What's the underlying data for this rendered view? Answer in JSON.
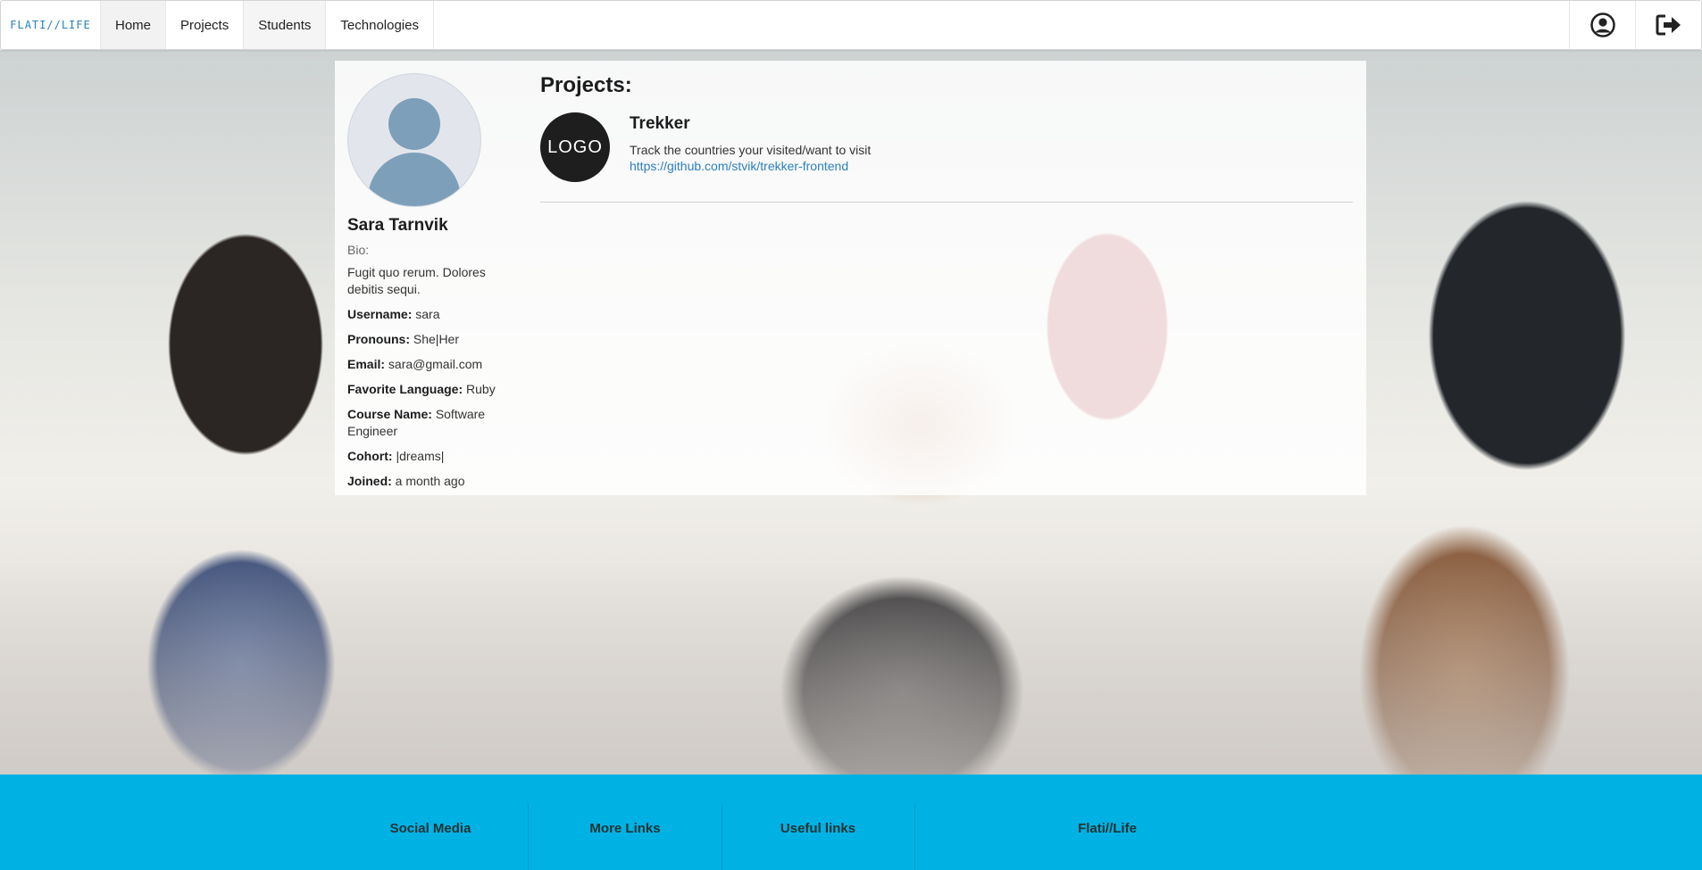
{
  "nav": {
    "logo": "FLATI//LIFE",
    "items": [
      "Home",
      "Projects",
      "Students",
      "Technologies"
    ]
  },
  "profile": {
    "name": "Sara Tarnvik",
    "bio_label": "Bio:",
    "bio": "Fugit quo rerum. Dolores debitis sequi.",
    "fields": [
      {
        "label": "Username:",
        "value": "sara"
      },
      {
        "label": "Pronouns:",
        "value": "She|Her"
      },
      {
        "label": "Email:",
        "value": "sara@gmail.com"
      },
      {
        "label": "Favorite Language:",
        "value": "Ruby"
      },
      {
        "label": "Course Name:",
        "value": "Software Engineer"
      },
      {
        "label": "Cohort:",
        "value": "|dreams|"
      },
      {
        "label": "Joined:",
        "value": "a month ago"
      }
    ]
  },
  "projects": {
    "heading": "Projects:",
    "items": [
      {
        "logo": "LOGO",
        "title": "Trekker",
        "description": "Track the countries your visited/want to visit",
        "link": "https://github.com/stvik/trekker-frontend"
      }
    ]
  },
  "footer": {
    "columns": [
      "Social Media",
      "More Links",
      "Useful links",
      "Flati//Life"
    ]
  },
  "colors": {
    "footer_bg": "#00b1e4",
    "link": "#2d7fc1"
  },
  "icons": [
    "user-circle-icon",
    "sign-out-icon"
  ]
}
